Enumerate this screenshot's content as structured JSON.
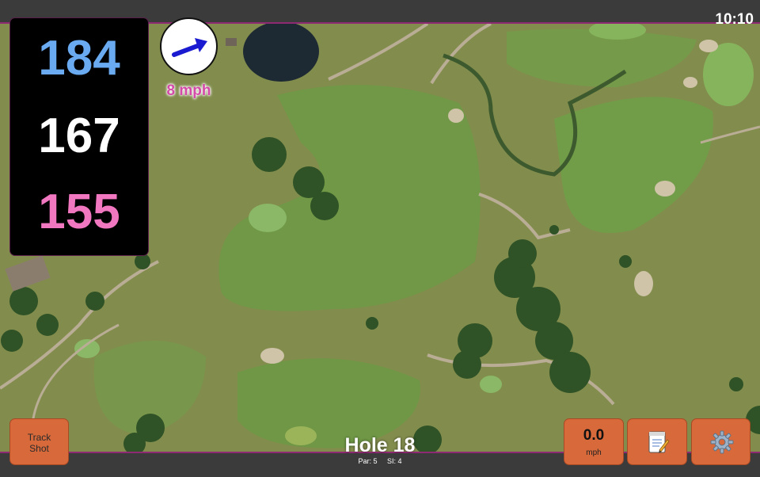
{
  "status": {
    "time": "10:10"
  },
  "distances": {
    "back": "184",
    "middle": "167",
    "front": "155"
  },
  "wind": {
    "speed_label": "8 mph",
    "icon": "wind-direction-arrow-icon"
  },
  "hole": {
    "title": "Hole 18",
    "par": "Par: 5",
    "stroke_index": "SI: 4"
  },
  "buttons": {
    "track_shot_line1": "Track",
    "track_shot_line2": "Shot",
    "speed_value": "0.0",
    "speed_unit": "mph",
    "notes_icon": "notepad-icon",
    "settings_icon": "gear-icon"
  },
  "colors": {
    "back_distance": "#6aaaf0",
    "middle_distance": "#ffffff",
    "front_distance": "#f277c1",
    "button": "#d7693a",
    "accent_border": "#8e2a73"
  }
}
